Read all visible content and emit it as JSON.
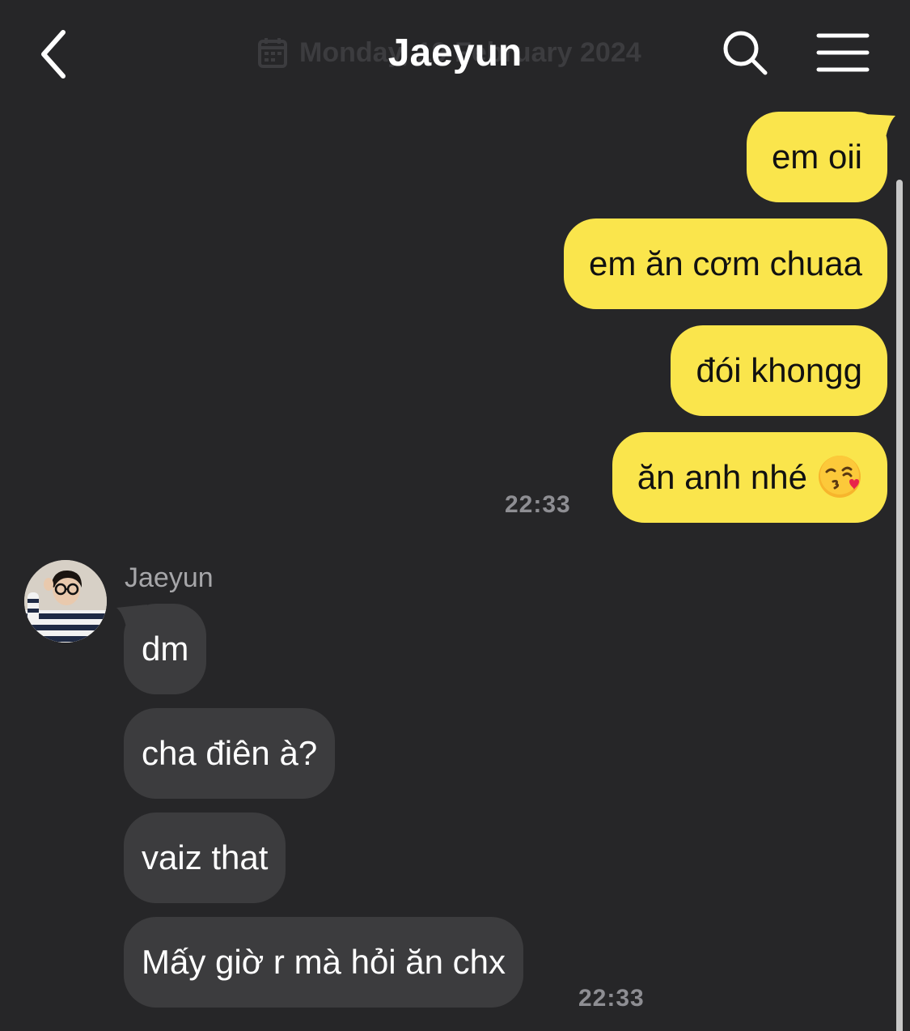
{
  "header": {
    "title": "Jaeyun",
    "date_ghost": "Monday, 19 February 2024"
  },
  "colors": {
    "background": "#262628",
    "outgoing_bubble": "#fae54c",
    "incoming_bubble": "#3c3c3e"
  },
  "icons": {
    "back": "chevron-left-icon",
    "date": "calendar-icon",
    "search": "search-icon",
    "menu": "hamburger-menu-icon",
    "emoji": "face-blowing-kiss"
  },
  "outgoing": {
    "messages": [
      "em oii",
      "em ăn cơm chuaa",
      "đói khongg",
      "ăn anh nhé"
    ],
    "time": "22:33"
  },
  "incoming": {
    "sender": "Jaeyun",
    "messages": [
      "dm",
      "cha điên à?",
      "vaiz that",
      "Mấy giờ r mà hỏi ăn chx"
    ],
    "time": "22:33"
  }
}
